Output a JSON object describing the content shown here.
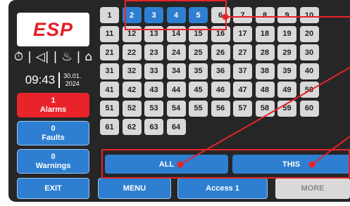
{
  "brand": {
    "logo_text": "ESP"
  },
  "status_icons": {
    "icon1": "⏱",
    "icon2": "◁|",
    "icon3": "♨",
    "icon4": "⌂"
  },
  "clock": {
    "time": "09:43",
    "date_line1": "30.01.",
    "date_line2": "2024"
  },
  "side_buttons": {
    "alarms": {
      "count": "1",
      "label": "Alarms"
    },
    "faults": {
      "count": "0",
      "label": "Faults"
    },
    "warnings": {
      "count": "0",
      "label": "Warnings"
    }
  },
  "grid": {
    "cells": [
      "1",
      "2",
      "3",
      "4",
      "5",
      "6",
      "7",
      "8",
      "9",
      "10",
      "11",
      "12",
      "13",
      "14",
      "15",
      "16",
      "17",
      "18",
      "19",
      "20",
      "21",
      "22",
      "23",
      "24",
      "25",
      "26",
      "27",
      "28",
      "29",
      "30",
      "31",
      "32",
      "33",
      "34",
      "35",
      "36",
      "37",
      "38",
      "39",
      "40",
      "41",
      "42",
      "43",
      "44",
      "45",
      "46",
      "47",
      "48",
      "49",
      "50",
      "51",
      "52",
      "53",
      "54",
      "55",
      "56",
      "57",
      "58",
      "59",
      "60",
      "61",
      "62",
      "63",
      "64"
    ],
    "selected": [
      "2",
      "3",
      "4",
      "5"
    ]
  },
  "actions": {
    "all_label": "ALL",
    "this_label": "THIS"
  },
  "bottom": {
    "exit": "EXIT",
    "menu": "MENU",
    "access": "Access 1",
    "more": "MORE"
  },
  "colors": {
    "accent_blue": "#2e7fd1",
    "alarm_red": "#e8242a",
    "panel_dark": "#262626",
    "cell_grey": "#d9d9d9"
  }
}
